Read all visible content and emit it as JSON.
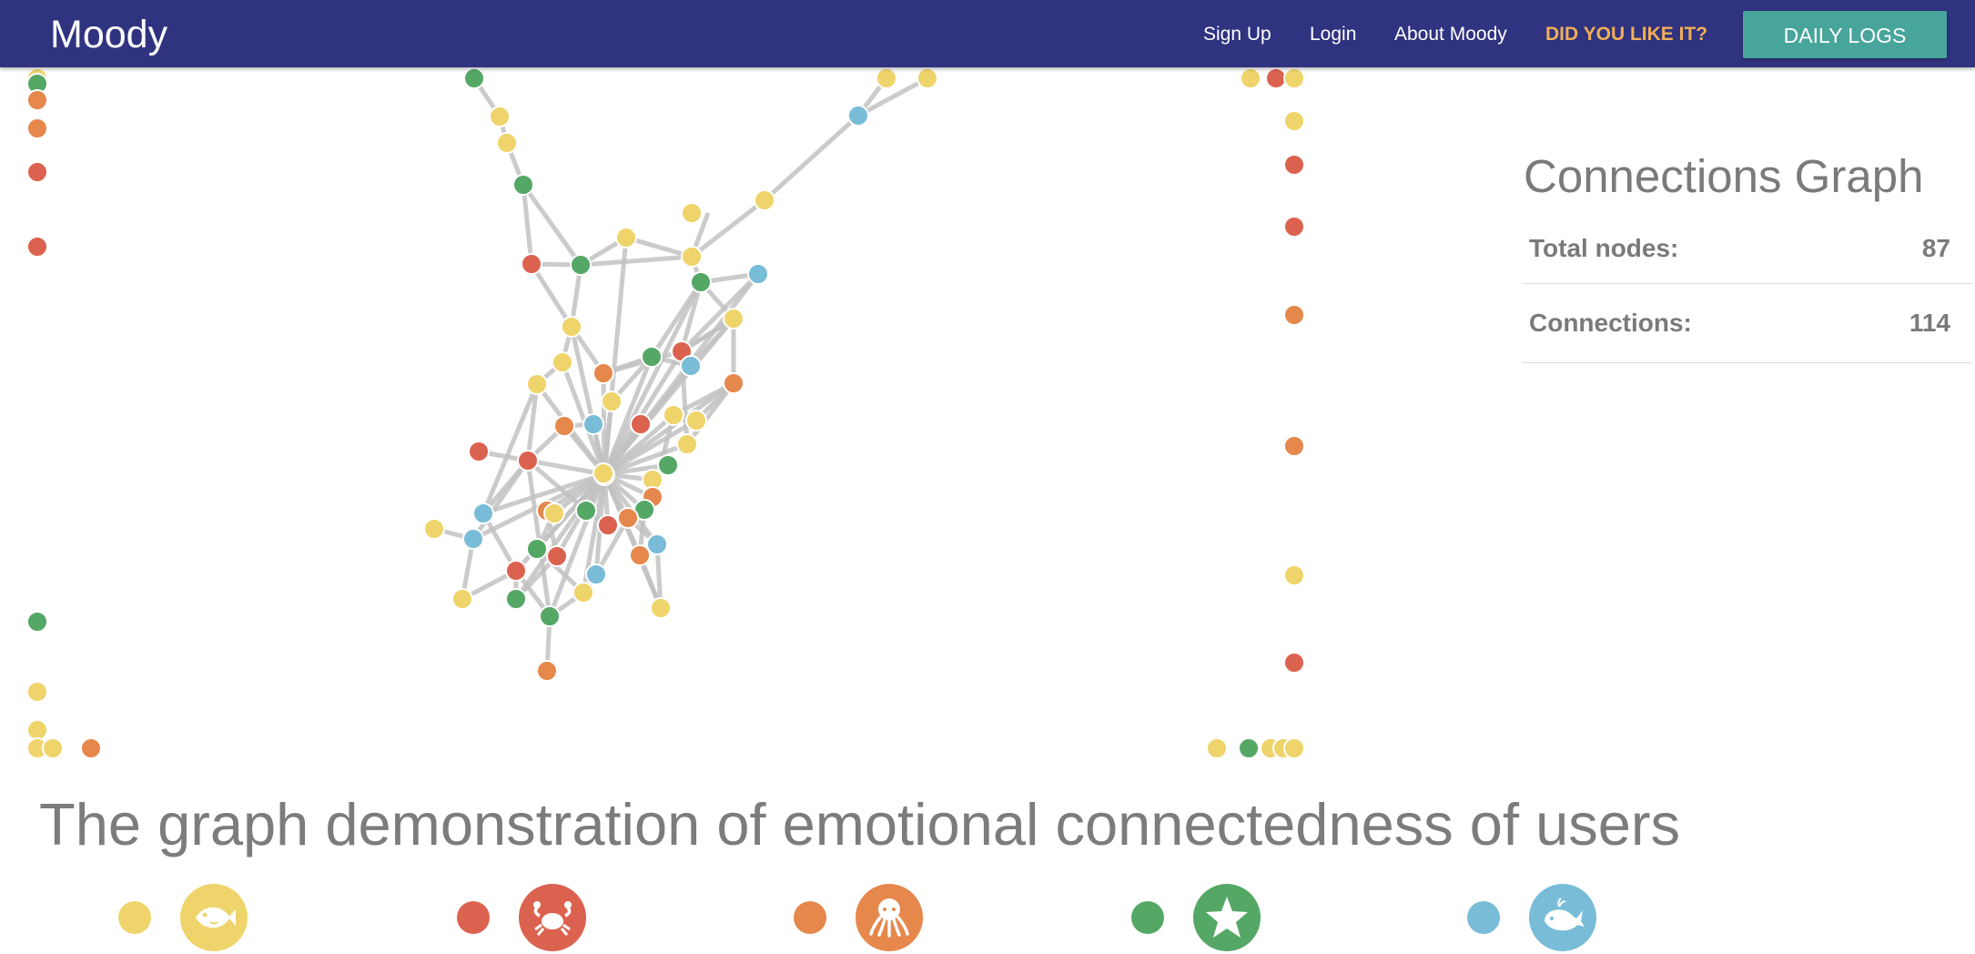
{
  "navbar": {
    "brand": "Moody",
    "links": [
      {
        "label": "Sign Up",
        "name": "nav-sign-up"
      },
      {
        "label": "Login",
        "name": "nav-login"
      },
      {
        "label": "About Moody",
        "name": "nav-about"
      },
      {
        "label": "DID YOU LIKE IT?",
        "name": "nav-feedback"
      }
    ],
    "cta_label": "DAILY LOGS",
    "colors": {
      "bar": "#303380",
      "cta": "#48a59b",
      "highlight": "#f0ae58"
    }
  },
  "panel": {
    "title": "Connections Graph",
    "total_nodes_label": "Total nodes:",
    "total_nodes_value": "87",
    "connections_label": "Connections:",
    "connections_value": "114"
  },
  "caption": "The graph demonstration of emotional connectedness of users",
  "mood_colors": {
    "yellow": "#efd46b",
    "red": "#dc6250",
    "orange": "#e6874c",
    "green": "#55a766",
    "blue": "#78bcd8"
  },
  "legend": [
    {
      "color": "yellow",
      "icon": "fish-icon"
    },
    {
      "color": "red",
      "icon": "crab-icon"
    },
    {
      "color": "orange",
      "icon": "octopus-icon"
    },
    {
      "color": "green",
      "icon": "starfish-icon"
    },
    {
      "color": "blue",
      "icon": "whale-icon"
    }
  ]
}
